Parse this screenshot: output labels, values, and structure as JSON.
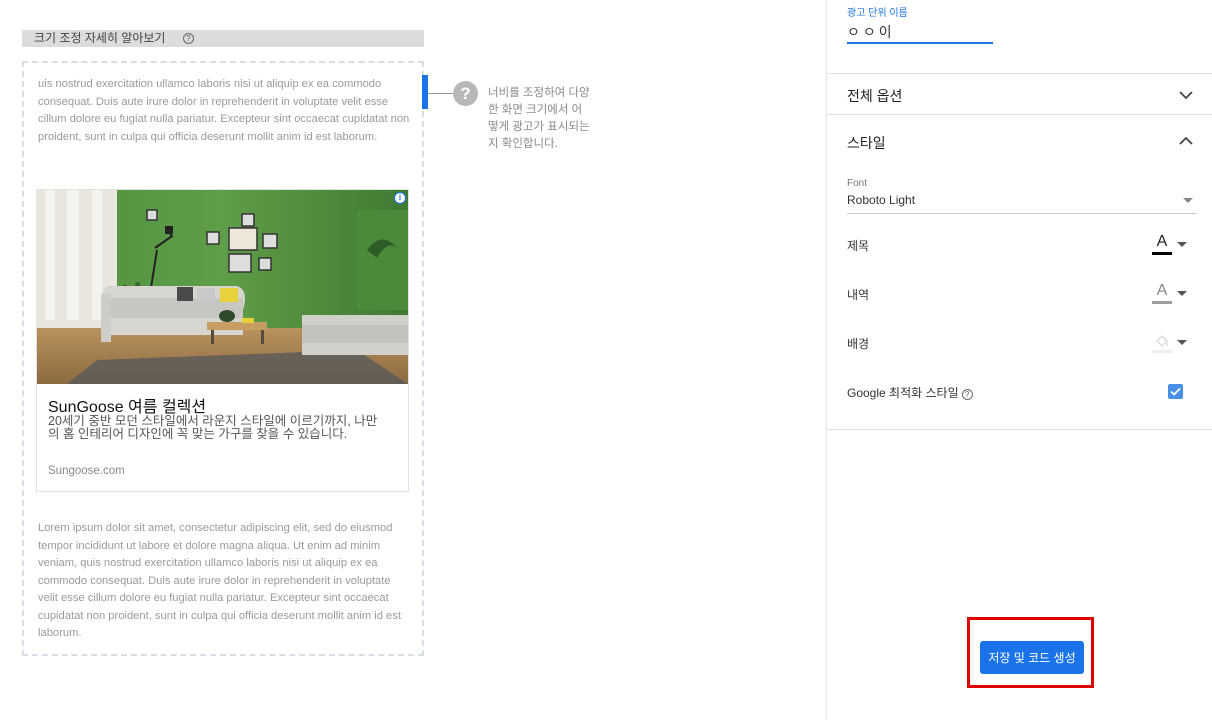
{
  "preview": {
    "resize_help_label": "크기 조정 자세히 알아보기",
    "help_icon_glyph": "?",
    "filler_top": "uis nostrud exercitation ullamco laboris nisi ut aliquip ex ea commodo consequat. Duis aute irure dolor in reprehenderit in voluptate velit esse cillum dolore eu fugiat nulla pariatur. Excepteur sint occaecat cupidatat non proident, sunt in culpa qui officia deserunt mollit anim id est laborum.",
    "filler_bottom": "Lorem ipsum dolor sit amet, consectetur adipiscing elit, sed do eiusmod tempor incididunt ut labore et dolore magna aliqua. Ut enim ad minim veniam, quis nostrud exercitation ullamco laboris nisi ut aliquip ex ea commodo consequat. Duis aute irure dolor in reprehenderit in voluptate velit esse cillum dolore eu fugiat nulla pariatur. Excepteur sint occaecat cupidatat non proident, sunt in culpa qui officia deserunt mollit anim id est laborum.",
    "callout_glyph": "?",
    "callout_text": "너비를 조정하여 다양한 화면 크기에서 어떻게 광고가 표시되는지 확인합니다.",
    "ad": {
      "adchoices_glyph": "i",
      "title": "SunGoose 여름 컬렉션",
      "body": "20세기 중반 모던 스타일에서 라운지 스타일에 이르기까지, 나만의 홈 인테리어 디자인에 꼭 맞는 가구를 찾을 수 있습니다.",
      "url": "Sungoose.com"
    }
  },
  "panel": {
    "ad_unit_name_label": "광고 단위 이름",
    "ad_unit_name_value": "ㅇㅇ이",
    "sections": {
      "all_options": "전체 옵션",
      "style": "스타일"
    },
    "font": {
      "caption": "Font",
      "value": "Roboto Light"
    },
    "style_rows": {
      "title_label": "제목",
      "body_label": "내역",
      "background_label": "배경",
      "title_color": "#000000",
      "body_color": "#9e9e9e",
      "background_color": "#eeeeee",
      "letter": "A"
    },
    "google_optimized_label": "Google 최적화 스타일",
    "google_optimized_checked": true,
    "help_glyph": "?",
    "save_button": "저장 및 코드 생성"
  },
  "colors": {
    "accent": "#1a73e8",
    "highlight": "#e00000"
  }
}
